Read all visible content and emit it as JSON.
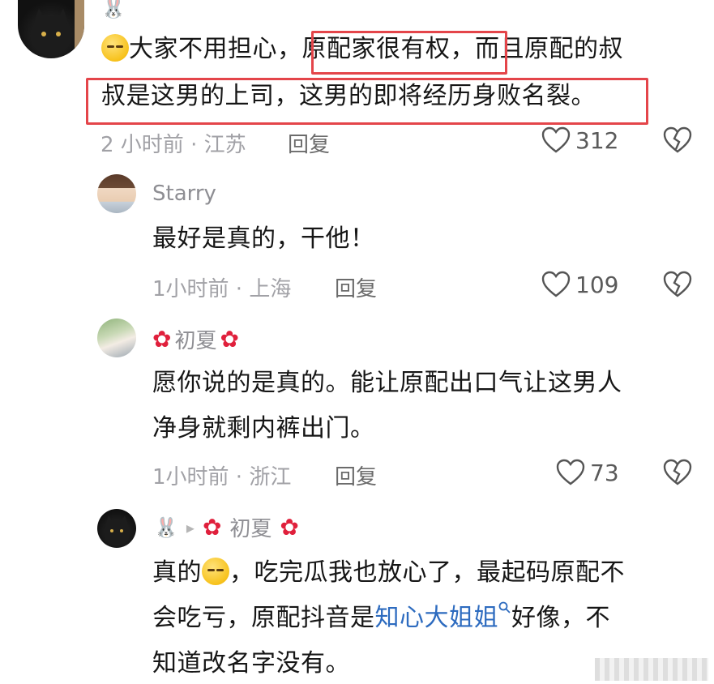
{
  "comments": [
    {
      "name": "🐰",
      "text_line1_a": "大家不用担心，",
      "text_line1_b": "原配家很有权",
      "text_line1_c": "，而且原配的叔",
      "text_line2": "叔是这男的上司，这男的即将经历身败名裂。",
      "meta": "2 小时前 · 江苏",
      "reply": "回复",
      "likes": "312"
    },
    {
      "name": "Starry",
      "text": "最好是真的，干他！",
      "meta": "1小时前 · 上海",
      "reply": "回复",
      "likes": "109"
    },
    {
      "name": "初夏",
      "text_line1": "愿你说的是真的。能让原配出口气让这男人",
      "text_line2": "净身就剩内裤出门。",
      "meta": "1小时前 · 浙江",
      "reply": "回复",
      "likes": "73"
    },
    {
      "name": "🐰",
      "reply_to": "初夏",
      "text_line1_a": "真的",
      "text_line1_b": "，吃完瓜我也放心了，最起码原配不",
      "text_line2_a": "会吃亏，原配抖音是",
      "text_line2_link": "知心大姐姐",
      "text_line2_b": "好像，不",
      "text_line3": "知道改名字没有。"
    }
  ],
  "icons": {
    "heart": "♡",
    "dislike": "broken-heart",
    "flower": "✿",
    "triangle": "▸",
    "search": "search"
  },
  "colors": {
    "highlight": "#e4454a",
    "link": "#2d6bbf"
  }
}
